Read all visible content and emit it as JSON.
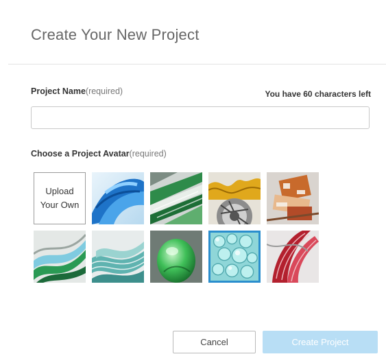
{
  "dialog": {
    "title": "Create Your New Project"
  },
  "project_name": {
    "label": "Project Name",
    "required": "(required)",
    "chars_left": "You have 60 characters left",
    "value": "",
    "placeholder": ""
  },
  "avatar": {
    "label": "Choose a Project Avatar",
    "required": "(required)",
    "upload_label": "Upload\nYour Own",
    "selected_index": 8,
    "items": [
      {
        "icon": "blue-wave-avatar-icon"
      },
      {
        "icon": "green-stripe-avatar-icon"
      },
      {
        "icon": "gold-gear-avatar-icon"
      },
      {
        "icon": "orange-machinery-avatar-icon"
      },
      {
        "icon": "green-twist-avatar-icon"
      },
      {
        "icon": "teal-ribbon-avatar-icon"
      },
      {
        "icon": "green-egg-avatar-icon"
      },
      {
        "icon": "aqua-cells-avatar-icon"
      },
      {
        "icon": "red-muscle-avatar-icon"
      }
    ]
  },
  "buttons": {
    "cancel": "Cancel",
    "create": "Create Project"
  },
  "colors": {
    "accent": "#2a8ecd",
    "create_disabled": "#b8def5"
  }
}
